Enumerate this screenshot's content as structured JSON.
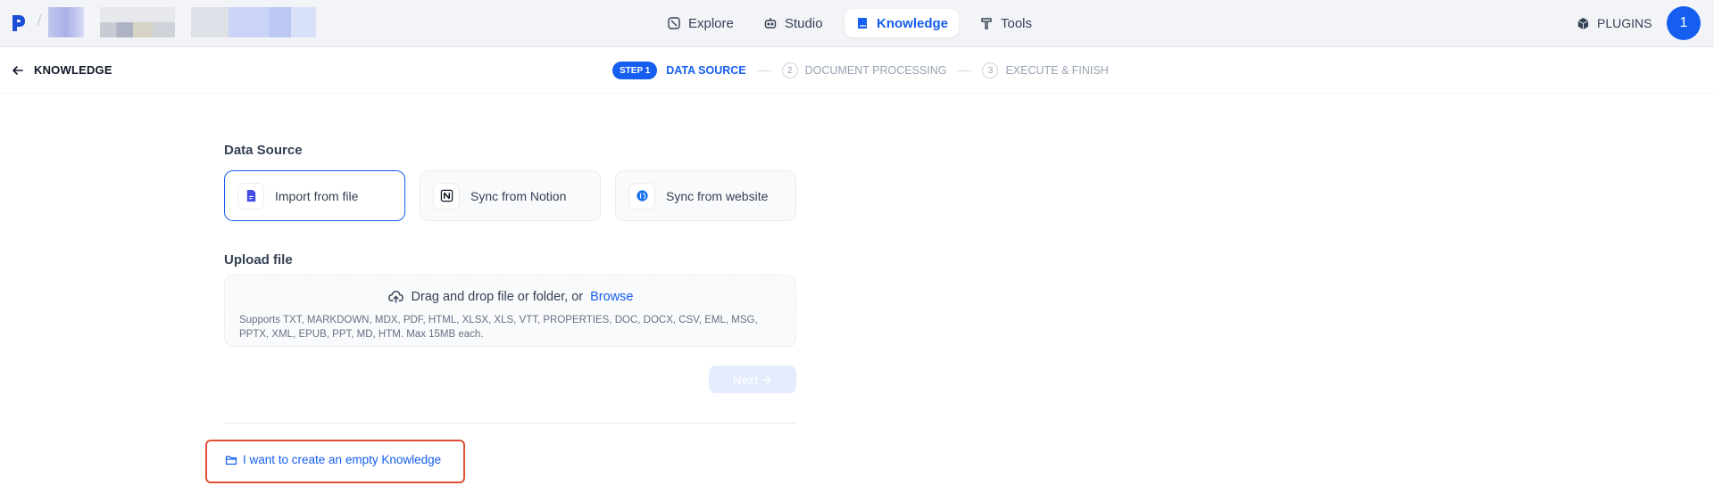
{
  "topbar": {
    "nav": {
      "explore": "Explore",
      "studio": "Studio",
      "knowledge": "Knowledge",
      "tools": "Tools"
    },
    "plugins": "PLUGINS",
    "avatar_initial": "1",
    "logo_separator": "/"
  },
  "subheader": {
    "back_label": "KNOWLEDGE",
    "steps": {
      "badge": "STEP 1",
      "step1": "DATA SOURCE",
      "step2_num": "2",
      "step2": "DOCUMENT PROCESSING",
      "step3_num": "3",
      "step3": "EXECUTE & FINISH"
    }
  },
  "main": {
    "data_source_title": "Data Source",
    "sources": {
      "file": "Import from file",
      "notion": "Sync from Notion",
      "website": "Sync from website"
    },
    "upload_title": "Upload file",
    "dropzone": {
      "text": "Drag and drop file or folder, or",
      "browse": "Browse",
      "support": "Supports TXT, MARKDOWN, MDX, PDF, HTML, XLSX, XLS, VTT, PROPERTIES, DOC, DOCX, CSV, EML, MSG, PPTX, XML, EPUB, PPT, MD, HTM. Max 15MB each."
    },
    "next": "Next",
    "empty_link": "I want to create an empty Knowledge"
  },
  "colors": {
    "accent": "#155eef",
    "highlight_box": "#e04f35"
  }
}
